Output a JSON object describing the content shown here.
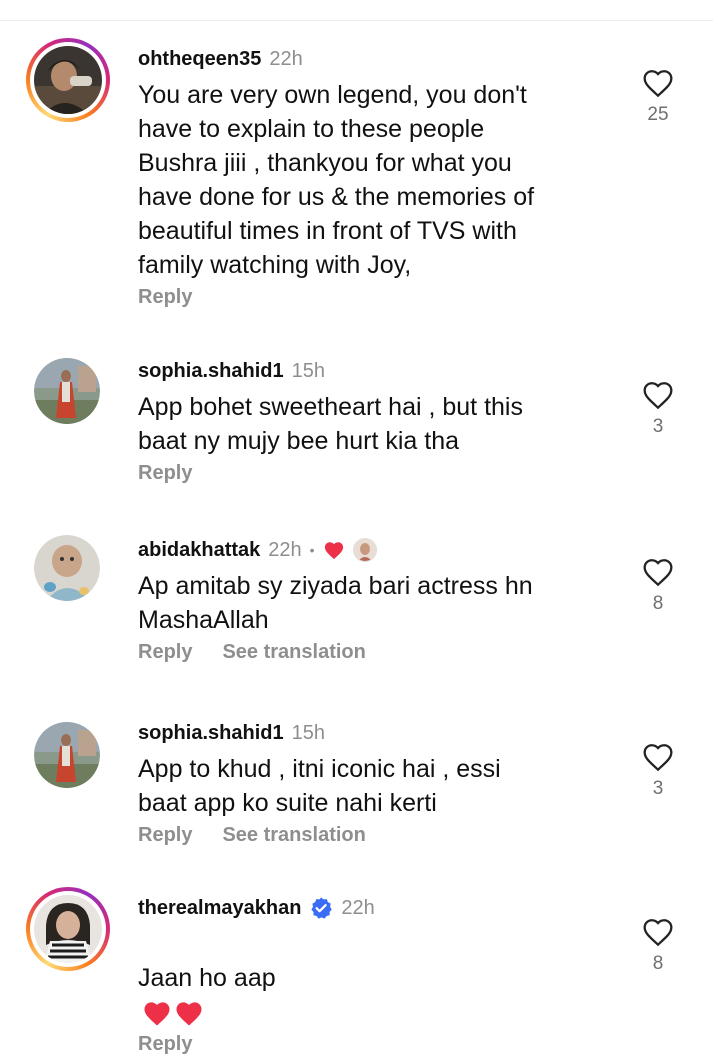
{
  "comments": [
    {
      "username": "ohtheqeen35",
      "time": "22h",
      "text": "You are very own legend, you don't\nhave to explain to these people\nBushra jiii , thankyou for what you\nhave done for us & the memories of\nbeautiful times in front of TVS with\nfamily watching with Joy,",
      "reply_label": "Reply",
      "like_count": "25"
    },
    {
      "username": "sophia.shahid1",
      "time": "15h",
      "text": "App bohet sweetheart hai , but this\nbaat ny mujy bee hurt kia tha",
      "reply_label": "Reply",
      "like_count": "3"
    },
    {
      "username": "abidakhattak",
      "time": "22h",
      "dot": "•",
      "text": "Ap amitab  sy ziyada bari actress hn\nMashaAllah",
      "reply_label": "Reply",
      "translation_label": "See translation",
      "like_count": "8"
    },
    {
      "username": "sophia.shahid1",
      "time": "15h",
      "text": "App to khud , itni iconic hai , essi\nbaat app ko suite nahi kerti",
      "reply_label": "Reply",
      "translation_label": "See translation",
      "like_count": "3"
    },
    {
      "username": "therealmayakhan",
      "time": "22h",
      "text": "Jaan ho aap",
      "reply_label": "Reply",
      "like_count": "8"
    }
  ],
  "icons": {
    "like": "heart-outline-icon",
    "verified": "verified-badge-icon",
    "creator_liked": "red-heart-icon"
  },
  "colors": {
    "verified": "#3b6cf6",
    "heart_red": "#ed2f47",
    "muted": "#8e8e8e"
  }
}
